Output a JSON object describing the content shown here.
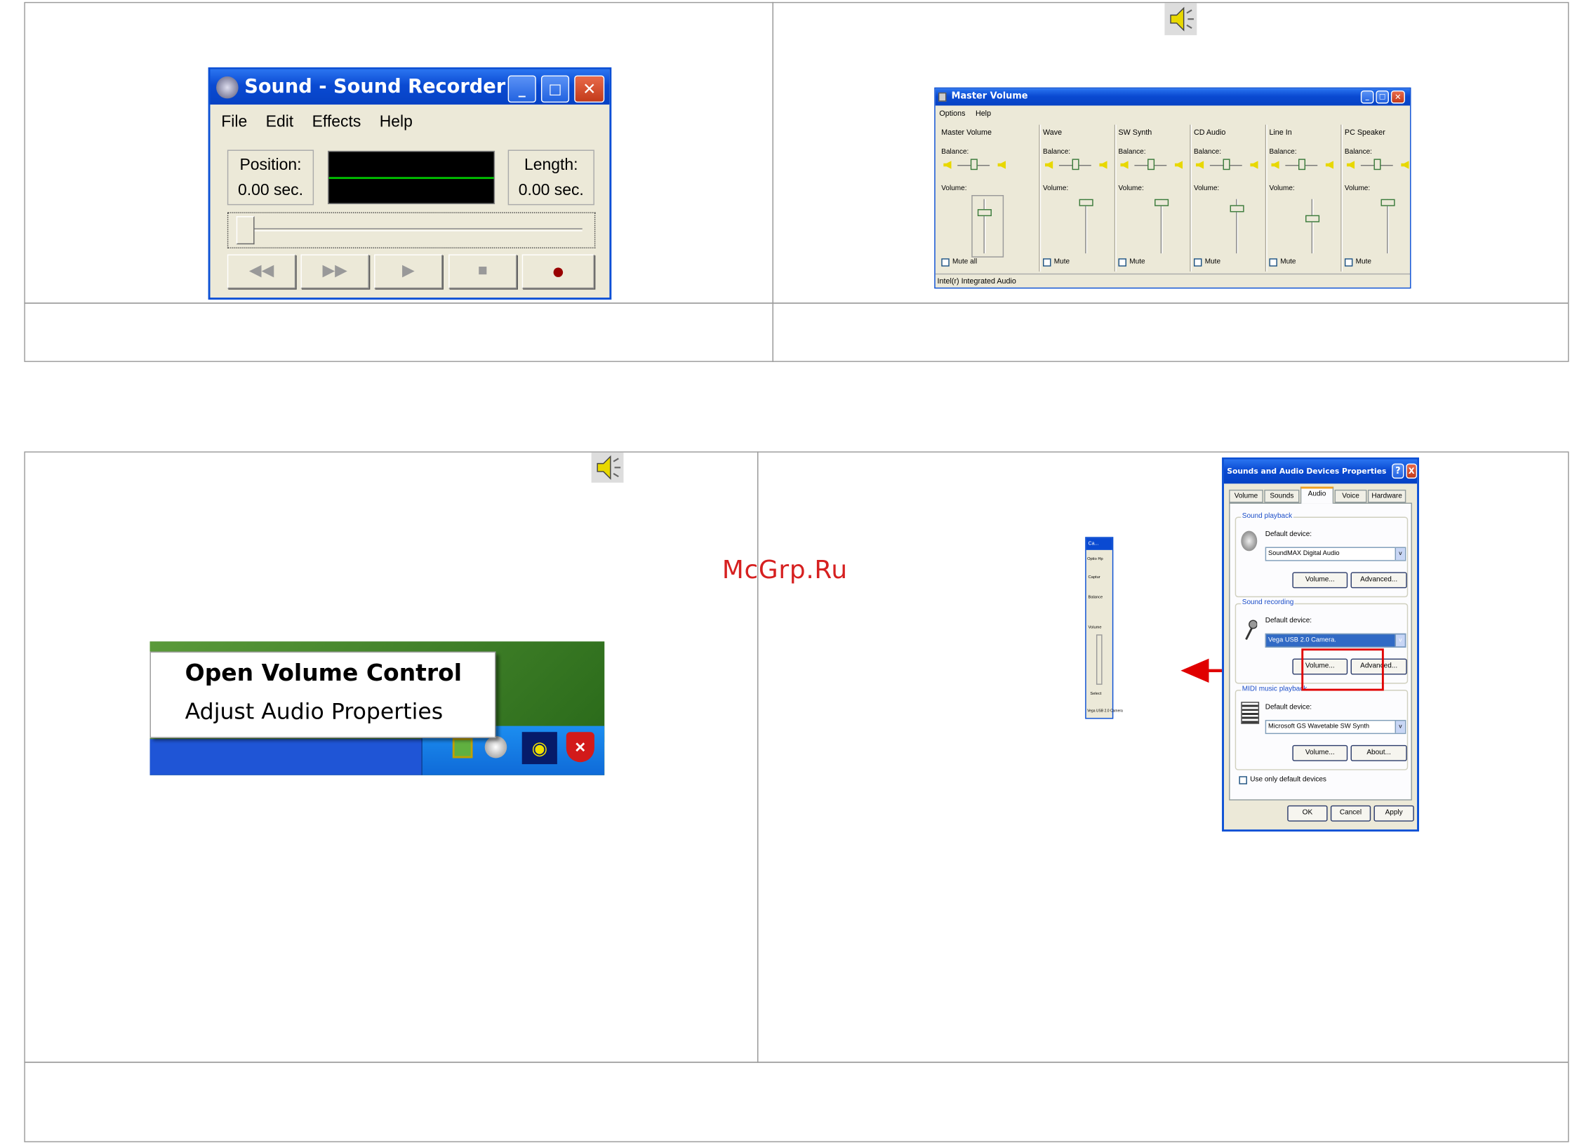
{
  "recorder": {
    "title": "Sound - Sound Recorder",
    "menu": [
      "File",
      "Edit",
      "Effects",
      "Help"
    ],
    "position_label": "Position:",
    "position_value": "0.00 sec.",
    "length_label": "Length:",
    "length_value": "0.00 sec.",
    "buttons": {
      "rewind": "◀◀",
      "forward": "▶▶",
      "play": "▶",
      "stop": "■",
      "record": "●"
    }
  },
  "mixer": {
    "title": "Master Volume",
    "menu": [
      "Options",
      "Help"
    ],
    "channels": [
      {
        "name": "Master Volume",
        "mute": "Mute all"
      },
      {
        "name": "Wave",
        "mute": "Mute"
      },
      {
        "name": "SW Synth",
        "mute": "Mute"
      },
      {
        "name": "CD Audio",
        "mute": "Mute"
      },
      {
        "name": "Line In",
        "mute": "Mute"
      },
      {
        "name": "PC Speaker",
        "mute": "Mute"
      }
    ],
    "balance_label": "Balance:",
    "volume_label": "Volume:",
    "status": "Intel(r) Integrated Audio"
  },
  "context_menu": {
    "items": [
      "Open Volume Control",
      "Adjust Audio Properties"
    ]
  },
  "watermark": "McGrp.Ru",
  "properties": {
    "title": "Sounds and Audio Devices Properties",
    "help_btn": "?",
    "close_btn": "X",
    "tabs": [
      "Volume",
      "Sounds",
      "Audio",
      "Voice",
      "Hardware"
    ],
    "active_tab": "Audio",
    "playback": {
      "group": "Sound playback",
      "label": "Default device:",
      "device": "SoundMAX Digital Audio",
      "volume_btn": "Volume...",
      "advanced_btn": "Advanced..."
    },
    "recording": {
      "group": "Sound recording",
      "label": "Default device:",
      "device": "Vega USB 2.0 Camera.",
      "volume_btn": "Volume...",
      "advanced_btn": "Advanced..."
    },
    "midi": {
      "group": "MIDI music playback",
      "label": "Default device:",
      "device": "Microsoft GS Wavetable SW Synth",
      "volume_btn": "Volume...",
      "about_btn": "About..."
    },
    "use_default": "Use only default devices",
    "ok": "OK",
    "cancel": "Cancel",
    "apply": "Apply"
  },
  "mini_window": {
    "title": "Ca...",
    "menu": "Optio Hp",
    "label1": "Captur",
    "label2": "Balance",
    "label3": "Volume",
    "select": "Select",
    "status": "Vega USB 2.0 Camera"
  },
  "colors": {
    "xp_blue": "#0a4fd6",
    "highlight_red": "#e00000",
    "taskbar": "#1f55d6"
  }
}
